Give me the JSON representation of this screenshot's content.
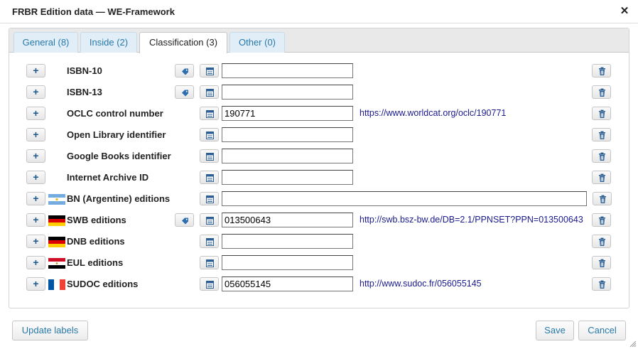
{
  "dialog": {
    "title": "FRBR Edition data — WE-Framework",
    "close_glyph": "✕"
  },
  "tabs": [
    {
      "label": "General (8)",
      "active": false
    },
    {
      "label": "Inside (2)",
      "active": false
    },
    {
      "label": "Classification (3)",
      "active": true
    },
    {
      "label": "Other (0)",
      "active": false
    }
  ],
  "rows": [
    {
      "label": "ISBN-10",
      "value": "",
      "link": "",
      "flag": null,
      "has_tag_button": true
    },
    {
      "label": "ISBN-13",
      "value": "",
      "link": "",
      "flag": null,
      "has_tag_button": true
    },
    {
      "label": "OCLC control number",
      "value": "190771",
      "link": "https://www.worldcat.org/oclc/190771",
      "flag": null,
      "has_tag_button": false
    },
    {
      "label": "Open Library identifier",
      "value": "",
      "link": "",
      "flag": null,
      "has_tag_button": false
    },
    {
      "label": "Google Books identifier",
      "value": "",
      "link": "",
      "flag": null,
      "has_tag_button": false
    },
    {
      "label": "Internet Archive ID",
      "value": "",
      "link": "",
      "flag": null,
      "has_tag_button": false
    },
    {
      "label": "BN (Argentine) editions",
      "value": "",
      "link": "",
      "flag": "argentina-flag",
      "has_tag_button": false
    },
    {
      "label": "SWB editions",
      "value": "013500643",
      "link": "http://swb.bsz-bw.de/DB=2.1/PPNSET?PPN=013500643",
      "flag": "germany-flag",
      "has_tag_button": true
    },
    {
      "label": "DNB editions",
      "value": "",
      "link": "",
      "flag": "germany-flag",
      "has_tag_button": false
    },
    {
      "label": "EUL editions",
      "value": "",
      "link": "",
      "flag": "egypt-flag",
      "has_tag_button": false
    },
    {
      "label": "SUDOC editions",
      "value": "056055145",
      "link": "http://www.sudoc.fr/056055145",
      "flag": "france-flag",
      "has_tag_button": false
    }
  ],
  "icons": {
    "add": "+",
    "tag": "tag-icon",
    "select": "list-select-icon",
    "delete": "trash-icon"
  },
  "footer": {
    "update_labels": "Update labels",
    "save": "Save",
    "cancel": "Cancel"
  },
  "colors": {
    "tab_inactive_bg": "#e2eef7",
    "tab_inactive_text": "#2779aa",
    "link": "#1a1a8e",
    "button_text": "#2779aa"
  }
}
